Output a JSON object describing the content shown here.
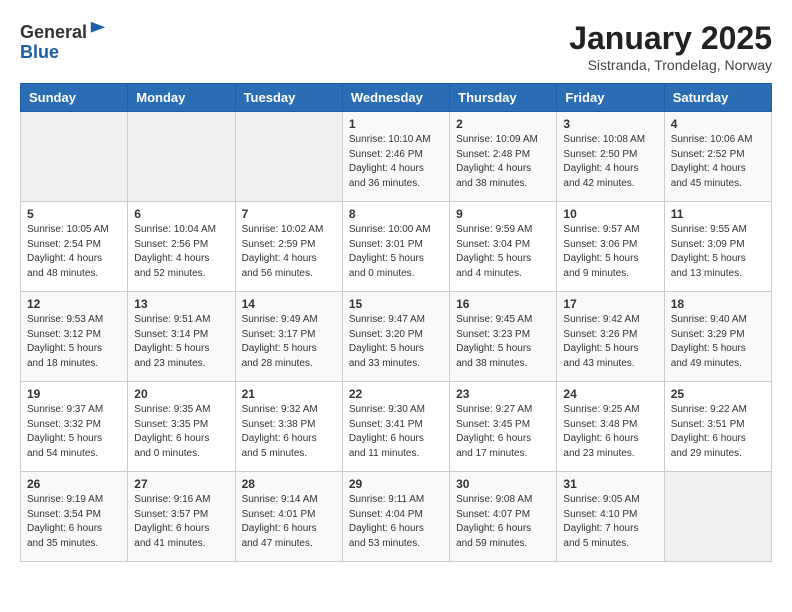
{
  "logo": {
    "general": "General",
    "blue": "Blue"
  },
  "title": "January 2025",
  "subtitle": "Sistranda, Trondelag, Norway",
  "days_of_week": [
    "Sunday",
    "Monday",
    "Tuesday",
    "Wednesday",
    "Thursday",
    "Friday",
    "Saturday"
  ],
  "weeks": [
    [
      {
        "day": "",
        "info": ""
      },
      {
        "day": "",
        "info": ""
      },
      {
        "day": "",
        "info": ""
      },
      {
        "day": "1",
        "info": "Sunrise: 10:10 AM\nSunset: 2:46 PM\nDaylight: 4 hours\nand 36 minutes."
      },
      {
        "day": "2",
        "info": "Sunrise: 10:09 AM\nSunset: 2:48 PM\nDaylight: 4 hours\nand 38 minutes."
      },
      {
        "day": "3",
        "info": "Sunrise: 10:08 AM\nSunset: 2:50 PM\nDaylight: 4 hours\nand 42 minutes."
      },
      {
        "day": "4",
        "info": "Sunrise: 10:06 AM\nSunset: 2:52 PM\nDaylight: 4 hours\nand 45 minutes."
      }
    ],
    [
      {
        "day": "5",
        "info": "Sunrise: 10:05 AM\nSunset: 2:54 PM\nDaylight: 4 hours\nand 48 minutes."
      },
      {
        "day": "6",
        "info": "Sunrise: 10:04 AM\nSunset: 2:56 PM\nDaylight: 4 hours\nand 52 minutes."
      },
      {
        "day": "7",
        "info": "Sunrise: 10:02 AM\nSunset: 2:59 PM\nDaylight: 4 hours\nand 56 minutes."
      },
      {
        "day": "8",
        "info": "Sunrise: 10:00 AM\nSunset: 3:01 PM\nDaylight: 5 hours\nand 0 minutes."
      },
      {
        "day": "9",
        "info": "Sunrise: 9:59 AM\nSunset: 3:04 PM\nDaylight: 5 hours\nand 4 minutes."
      },
      {
        "day": "10",
        "info": "Sunrise: 9:57 AM\nSunset: 3:06 PM\nDaylight: 5 hours\nand 9 minutes."
      },
      {
        "day": "11",
        "info": "Sunrise: 9:55 AM\nSunset: 3:09 PM\nDaylight: 5 hours\nand 13 minutes."
      }
    ],
    [
      {
        "day": "12",
        "info": "Sunrise: 9:53 AM\nSunset: 3:12 PM\nDaylight: 5 hours\nand 18 minutes."
      },
      {
        "day": "13",
        "info": "Sunrise: 9:51 AM\nSunset: 3:14 PM\nDaylight: 5 hours\nand 23 minutes."
      },
      {
        "day": "14",
        "info": "Sunrise: 9:49 AM\nSunset: 3:17 PM\nDaylight: 5 hours\nand 28 minutes."
      },
      {
        "day": "15",
        "info": "Sunrise: 9:47 AM\nSunset: 3:20 PM\nDaylight: 5 hours\nand 33 minutes."
      },
      {
        "day": "16",
        "info": "Sunrise: 9:45 AM\nSunset: 3:23 PM\nDaylight: 5 hours\nand 38 minutes."
      },
      {
        "day": "17",
        "info": "Sunrise: 9:42 AM\nSunset: 3:26 PM\nDaylight: 5 hours\nand 43 minutes."
      },
      {
        "day": "18",
        "info": "Sunrise: 9:40 AM\nSunset: 3:29 PM\nDaylight: 5 hours\nand 49 minutes."
      }
    ],
    [
      {
        "day": "19",
        "info": "Sunrise: 9:37 AM\nSunset: 3:32 PM\nDaylight: 5 hours\nand 54 minutes."
      },
      {
        "day": "20",
        "info": "Sunrise: 9:35 AM\nSunset: 3:35 PM\nDaylight: 6 hours\nand 0 minutes."
      },
      {
        "day": "21",
        "info": "Sunrise: 9:32 AM\nSunset: 3:38 PM\nDaylight: 6 hours\nand 5 minutes."
      },
      {
        "day": "22",
        "info": "Sunrise: 9:30 AM\nSunset: 3:41 PM\nDaylight: 6 hours\nand 11 minutes."
      },
      {
        "day": "23",
        "info": "Sunrise: 9:27 AM\nSunset: 3:45 PM\nDaylight: 6 hours\nand 17 minutes."
      },
      {
        "day": "24",
        "info": "Sunrise: 9:25 AM\nSunset: 3:48 PM\nDaylight: 6 hours\nand 23 minutes."
      },
      {
        "day": "25",
        "info": "Sunrise: 9:22 AM\nSunset: 3:51 PM\nDaylight: 6 hours\nand 29 minutes."
      }
    ],
    [
      {
        "day": "26",
        "info": "Sunrise: 9:19 AM\nSunset: 3:54 PM\nDaylight: 6 hours\nand 35 minutes."
      },
      {
        "day": "27",
        "info": "Sunrise: 9:16 AM\nSunset: 3:57 PM\nDaylight: 6 hours\nand 41 minutes."
      },
      {
        "day": "28",
        "info": "Sunrise: 9:14 AM\nSunset: 4:01 PM\nDaylight: 6 hours\nand 47 minutes."
      },
      {
        "day": "29",
        "info": "Sunrise: 9:11 AM\nSunset: 4:04 PM\nDaylight: 6 hours\nand 53 minutes."
      },
      {
        "day": "30",
        "info": "Sunrise: 9:08 AM\nSunset: 4:07 PM\nDaylight: 6 hours\nand 59 minutes."
      },
      {
        "day": "31",
        "info": "Sunrise: 9:05 AM\nSunset: 4:10 PM\nDaylight: 7 hours\nand 5 minutes."
      },
      {
        "day": "",
        "info": ""
      }
    ]
  ]
}
